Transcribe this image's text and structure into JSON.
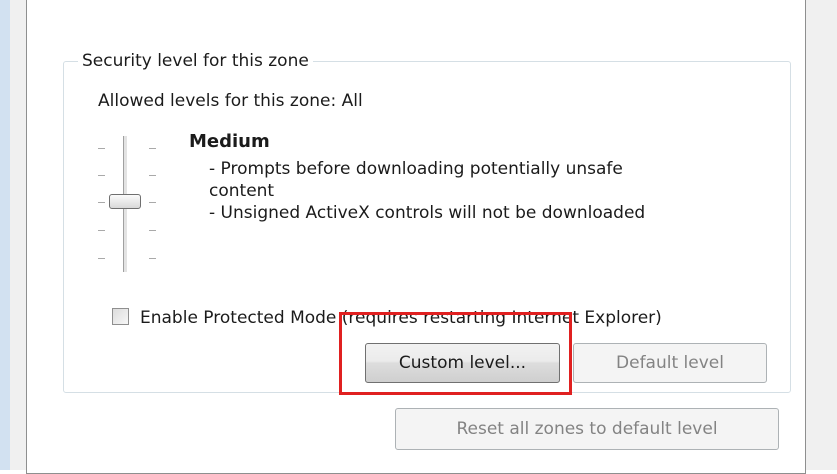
{
  "window": {
    "accent_left_strip": "#d2e1f1",
    "highlight_color": "#e02020"
  },
  "security_group": {
    "title": "Security level for this zone",
    "allowed_levels": "Allowed levels for this zone: All",
    "slider": {
      "levels_count": 5,
      "selected_index_from_top": 2
    },
    "level": {
      "name": "Medium",
      "desc_line1": "- Prompts before downloading potentially unsafe",
      "desc_line1_cont": "content",
      "desc_line2": "- Unsigned ActiveX controls will not be downloaded"
    },
    "protected_mode": {
      "label": "Enable Protected Mode (requires restarting Internet Explorer)",
      "checked": false
    },
    "buttons": {
      "custom_level": "Custom level...",
      "default_level": "Default level"
    }
  },
  "footer": {
    "reset_all": "Reset all zones to default level"
  }
}
